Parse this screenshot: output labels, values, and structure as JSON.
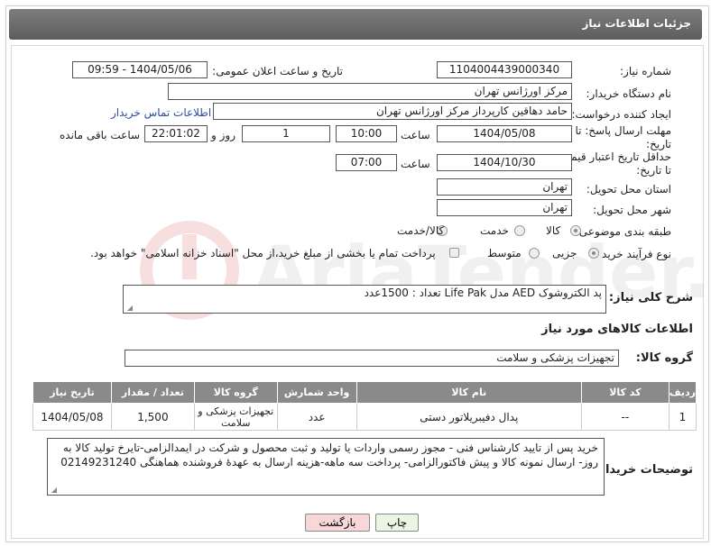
{
  "header": {
    "title": "جزئیات اطلاعات نیاز"
  },
  "form": {
    "need_number_label": "شماره نیاز:",
    "need_number": "1104004439000340",
    "announce_label": "تاریخ و ساعت اعلان عمومی:",
    "announce_value": "1404/05/06 - 09:59",
    "buyer_org_label": "نام دستگاه خریدار:",
    "buyer_org": "مرکز اورژانس تهران",
    "requester_label": "ایجاد کننده درخواست:",
    "requester": "حامد دهاقین کارپرداز مرکز اورژانس تهران",
    "contact_link": "اطلاعات تماس خریدار",
    "deadline_label": "مهلت ارسال پاسخ: تا تاریخ:",
    "deadline_date": "1404/05/08",
    "time_label": "ساعت",
    "deadline_time": "10:00",
    "days_value": "1",
    "days_label": "روز و",
    "remaining_time": "22:01:02",
    "remaining_label": "ساعت باقی مانده",
    "validity_label": "حداقل تاریخ اعتبار قیمت: تا تاریخ:",
    "validity_date": "1404/10/30",
    "validity_time_label": "ساعت",
    "validity_time": "07:00",
    "province_label": "استان محل تحویل:",
    "province": "تهران",
    "city_label": "شهر محل تحویل:",
    "city": "تهران",
    "category_label": "طبقه بندی موضوعی:",
    "category_options": [
      "کالا",
      "خدمت",
      "کالا/خدمت"
    ],
    "process_label": "نوع فرآیند خرید :",
    "process_options": [
      "جزیی",
      "متوسط"
    ],
    "payment_note": "پرداخت تمام یا بخشی از مبلغ خرید،از محل \"اسناد خزانه اسلامی\" خواهد بود."
  },
  "description": {
    "label": "شرح کلی نیاز:",
    "text": "پد الکتروشوک AED مدل Life Pak تعداد : 1500عدد"
  },
  "goods_section": {
    "title": "اطلاعات کالاهای مورد نیاز",
    "group_label": "گروه کالا:",
    "group_value": "تجهیزات پزشکی و سلامت"
  },
  "table": {
    "headers": [
      "ردیف",
      "کد کالا",
      "نام کالا",
      "واحد شمارش",
      "گروه کالا",
      "تعداد / مقدار",
      "تاریخ نیاز"
    ],
    "rows": [
      [
        "1",
        "--",
        "پدال دفیبریلاتور دستی",
        "عدد",
        "تجهیزات پزشکی و سلامت",
        "1,500",
        "1404/05/08"
      ]
    ]
  },
  "buyer_notes": {
    "label": "توضیحات خریدار:",
    "text": "خرید پس از تایید کارشناس فنی - مجوز رسمی واردات یا تولید و ثبت محصول و شرکت در ایمدالزامی-تایرخ تولید کالا به روز- ارسال نمونه کالا و پیش فاکتورالزامی- پرداخت سه ماهه-هزینه ارسال به عهدهٔ فروشنده هماهنگی 02149231240"
  },
  "buttons": {
    "print": "چاپ",
    "back": "بازگشت"
  },
  "colors": {
    "header_bg": "#6b6b6b",
    "table_header_bg": "#8a8a8a",
    "link": "#2a4d9f",
    "back_button_bg": "#f7d7d7",
    "print_button_bg": "#eaf5e3"
  }
}
